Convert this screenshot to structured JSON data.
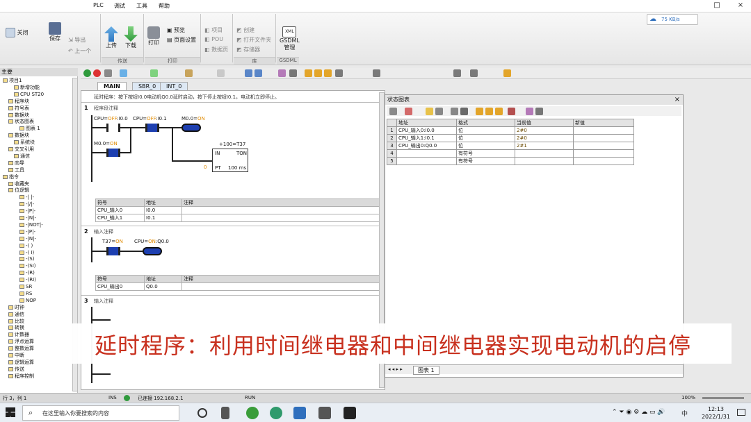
{
  "menu": [
    "PLC",
    "调试",
    "工具",
    "帮助"
  ],
  "window_controls": {
    "restore": "□",
    "close": "×"
  },
  "ribbon": {
    "file": {
      "close": "关闭",
      "save": "保存",
      "export": "导出",
      "previous": "上一个"
    },
    "transfer": {
      "upload": "上传",
      "download": "下载",
      "group": "传送"
    },
    "print": {
      "print": "打印",
      "preview": "预览",
      "page_setup": "页面设置",
      "group": "打印"
    },
    "items": {
      "project": "项目",
      "pou": "POU",
      "data_page": "数据页"
    },
    "create": {
      "create": "创建",
      "open_folder": "打开文件夹",
      "memory_card": "存储器",
      "group": "库"
    },
    "gsdml": {
      "label_xml": "XML",
      "label": "GSDML",
      "manager": "管理",
      "group": "GSDML"
    }
  },
  "network_widget": {
    "speed": "75 KB/s"
  },
  "left_panel": {
    "header": "主要",
    "tree": [
      {
        "label": "项目1",
        "indent": 0
      },
      {
        "label": "新增功能",
        "indent": 2
      },
      {
        "label": "CPU ST20",
        "indent": 2
      },
      {
        "label": "程序块",
        "indent": 1
      },
      {
        "label": "符号表",
        "indent": 1
      },
      {
        "label": "数据块",
        "indent": 1
      },
      {
        "label": "状态图表",
        "indent": 1
      },
      {
        "label": "图表 1",
        "indent": 3
      },
      {
        "label": "数据块",
        "indent": 1
      },
      {
        "label": "系统块",
        "indent": 2
      },
      {
        "label": "交叉引用",
        "indent": 1
      },
      {
        "label": "通信",
        "indent": 2
      },
      {
        "label": "向导",
        "indent": 1
      },
      {
        "label": "工具",
        "indent": 1
      },
      {
        "label": "指令",
        "indent": 0
      },
      {
        "label": "收藏夹",
        "indent": 1
      },
      {
        "label": "位逻辑",
        "indent": 1
      },
      {
        "label": "-|  |-",
        "indent": 3
      },
      {
        "label": "-|/|-",
        "indent": 3
      },
      {
        "label": "-|P|-",
        "indent": 3
      },
      {
        "label": "-|N|-",
        "indent": 3
      },
      {
        "label": "-|NOT|-",
        "indent": 3
      },
      {
        "label": "-|P|-",
        "indent": 3
      },
      {
        "label": "-|N|-",
        "indent": 3
      },
      {
        "label": "-( )",
        "indent": 3
      },
      {
        "label": "-( I)",
        "indent": 3
      },
      {
        "label": "-(S)",
        "indent": 3
      },
      {
        "label": "-(SI)",
        "indent": 3
      },
      {
        "label": "-(R)",
        "indent": 3
      },
      {
        "label": "-(RI)",
        "indent": 3
      },
      {
        "label": "SR",
        "indent": 3
      },
      {
        "label": "RS",
        "indent": 3
      },
      {
        "label": "NOP",
        "indent": 3
      },
      {
        "label": "时钟",
        "indent": 1
      },
      {
        "label": "通信",
        "indent": 1
      },
      {
        "label": "比较",
        "indent": 1
      },
      {
        "label": "转换",
        "indent": 1
      },
      {
        "label": "计数器",
        "indent": 1
      },
      {
        "label": "浮点运算",
        "indent": 1
      },
      {
        "label": "整数运算",
        "indent": 1
      },
      {
        "label": "中断",
        "indent": 1
      },
      {
        "label": "逻辑运算",
        "indent": 1
      },
      {
        "label": "传送",
        "indent": 1
      },
      {
        "label": "程序控制",
        "indent": 1
      }
    ]
  },
  "editor": {
    "tabs": [
      "MAIN",
      "SBR_0",
      "INT_0"
    ],
    "comment": "延时程序：按下按钮I0.0电动机Q0.0延时启动，按下停止按钮I0.1，电动机立即停止。",
    "networks": [
      {
        "num": "1",
        "title": "程序段注释",
        "contacts": {
          "c1": {
            "name": "CPU",
            "state": "OFF",
            "addr": "I0.0"
          },
          "c2": {
            "name": "CPU",
            "state": "OFF",
            "addr": "I0.1"
          },
          "m0": {
            "name": "M0.0",
            "state": "ON"
          },
          "coil": {
            "name": "M0.0",
            "state": "ON"
          }
        },
        "timer": {
          "preset_label": "+100",
          "name": "T37",
          "in": "IN",
          "type": "TON",
          "pt": "PT",
          "base": "100 ms",
          "preset_value": "0"
        },
        "symbols": {
          "headers": [
            "符号",
            "地址",
            "注释"
          ],
          "rows": [
            [
              "CPU_输入0",
              "I0.0",
              ""
            ],
            [
              "CPU_输入1",
              "I0.1",
              ""
            ]
          ]
        }
      },
      {
        "num": "2",
        "title": "输入注释",
        "contacts": {
          "c1": {
            "name": "T37",
            "state": "ON"
          },
          "coil": {
            "name": "CPU",
            "state": "ON",
            "addr": "Q0.0"
          }
        },
        "symbols": {
          "headers": [
            "符号",
            "地址",
            "注释"
          ],
          "rows": [
            [
              "CPU_输出0",
              "Q0.0",
              ""
            ]
          ]
        }
      },
      {
        "num": "3",
        "title": "输入注释"
      }
    ]
  },
  "status_chart": {
    "title": "状态图表",
    "close": "×",
    "headers": [
      "",
      "地址",
      "格式",
      "当前值",
      "新值"
    ],
    "rows": [
      [
        "1",
        "CPU_输入0:I0.0",
        "位",
        "2#0",
        ""
      ],
      [
        "2",
        "CPU_输入1:I0.1",
        "位",
        "2#0",
        ""
      ],
      [
        "3",
        "CPU_输出0:Q0.0",
        "位",
        "2#1",
        ""
      ],
      [
        "4",
        "",
        "有符号",
        "",
        ""
      ],
      [
        "5",
        "",
        "有符号",
        "",
        ""
      ]
    ],
    "tab": "图表 1"
  },
  "banner": "延时程序：利用时间继电器和中间继电器实现电动机的启停",
  "status_bar": {
    "position": "行 3，列 1",
    "mode": "INS",
    "connection": "已连接 192.168.2.1",
    "run": "RUN",
    "zoom": "100%"
  },
  "taskbar": {
    "search_placeholder": "在这里输入你要搜索的内容",
    "ime": "中",
    "time": "12:13",
    "date": "2022/1/31"
  },
  "colors": {
    "contact_on": "#1d3fb0",
    "status_orange": "#e08a00",
    "banner_text": "#c8301e"
  }
}
